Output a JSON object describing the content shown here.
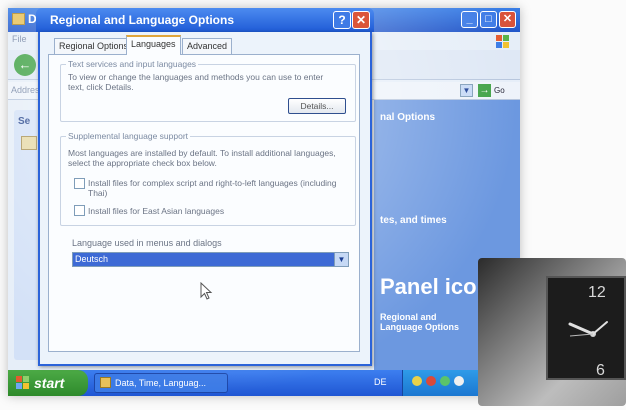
{
  "background_window": {
    "title": "Datu",
    "menu_hint": "File",
    "back_label": "B",
    "address_label": "Address",
    "go_label": "Go",
    "left_panel_heading": "Se",
    "heading_1": "nal Options",
    "heading_2": "tes, and times",
    "panel_big_text": "Panel ico",
    "regional_link": "Regional and Language Options"
  },
  "dialog": {
    "title": "Regional and Language Options",
    "help_label": "?",
    "close_label": "✕",
    "tabs": [
      {
        "label": "Regional Options"
      },
      {
        "label": "Languages"
      },
      {
        "label": "Advanced"
      }
    ],
    "active_tab": "Languages",
    "text_services": {
      "group_label": "Text services and input languages",
      "description": "To view or change the languages and methods you can use to enter text, click Details.",
      "details_button": "Details..."
    },
    "supplemental": {
      "group_label": "Supplemental language support",
      "description": "Most languages are installed by default. To install additional languages, select the appropriate check box below.",
      "checkbox_complex": "Install files for complex script and right-to-left languages (including Thai)",
      "checkbox_east_asian": "Install files for East Asian languages"
    },
    "ui_language": {
      "label": "Language used in menus and dialogs",
      "selected": "Deutsch"
    }
  },
  "taskbar": {
    "start_label": "start",
    "task_button": "Data, Time, Languag...",
    "language_indicator": "DE"
  },
  "clock": {
    "num_12": "12",
    "num_6": "6"
  },
  "colors": {
    "xp_blue": "#2f63d2",
    "start_green": "#3a9a35",
    "selection_blue": "#3d6ad5",
    "close_red": "#db5539"
  }
}
